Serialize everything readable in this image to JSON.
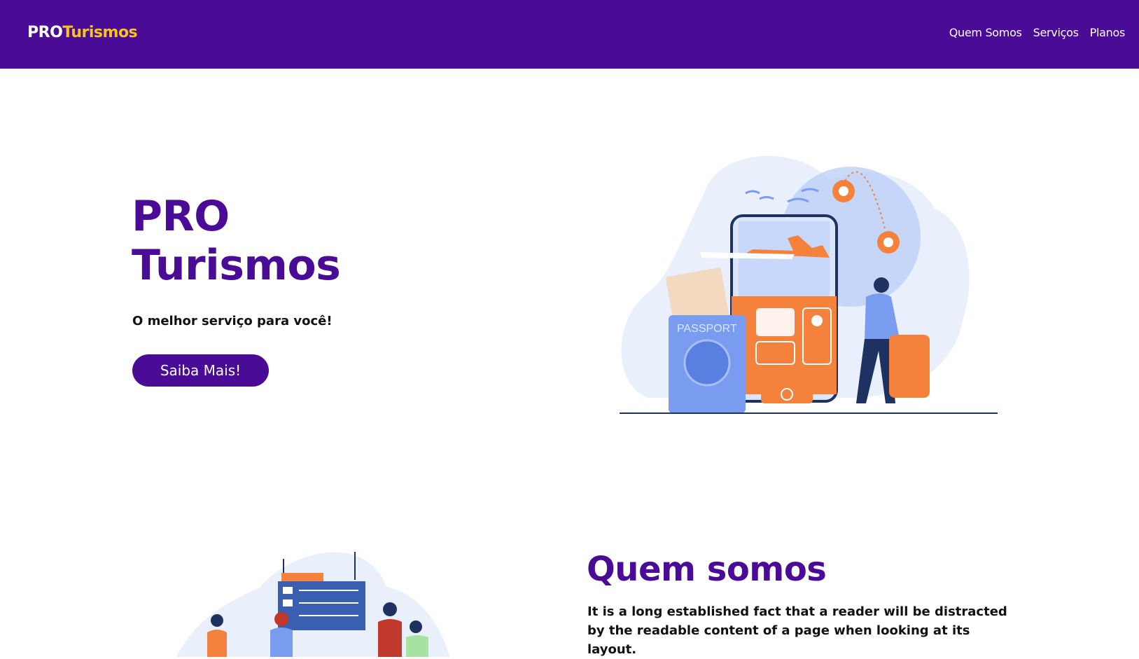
{
  "navbar": {
    "logo_pro": "PRO",
    "logo_turismos": "Turismos",
    "links": [
      "Quem Somos",
      "Serviços",
      "Planos"
    ]
  },
  "hero": {
    "title_line1": "PRO",
    "title_line2": "Turismos",
    "subtitle": "O melhor serviço para você!",
    "cta_label": "Saiba Mais!",
    "passport_text": "PASSPORT"
  },
  "about": {
    "title": "Quem somos",
    "text": "It is a long established fact that a reader will be distracted by the readable content of a page when looking at its layout."
  },
  "colors": {
    "brand_purple": "#4a0c96",
    "logo_yellow": "#f6c51b",
    "accent_orange": "#f4823c",
    "illustration_blue": "#7a9cf0"
  }
}
